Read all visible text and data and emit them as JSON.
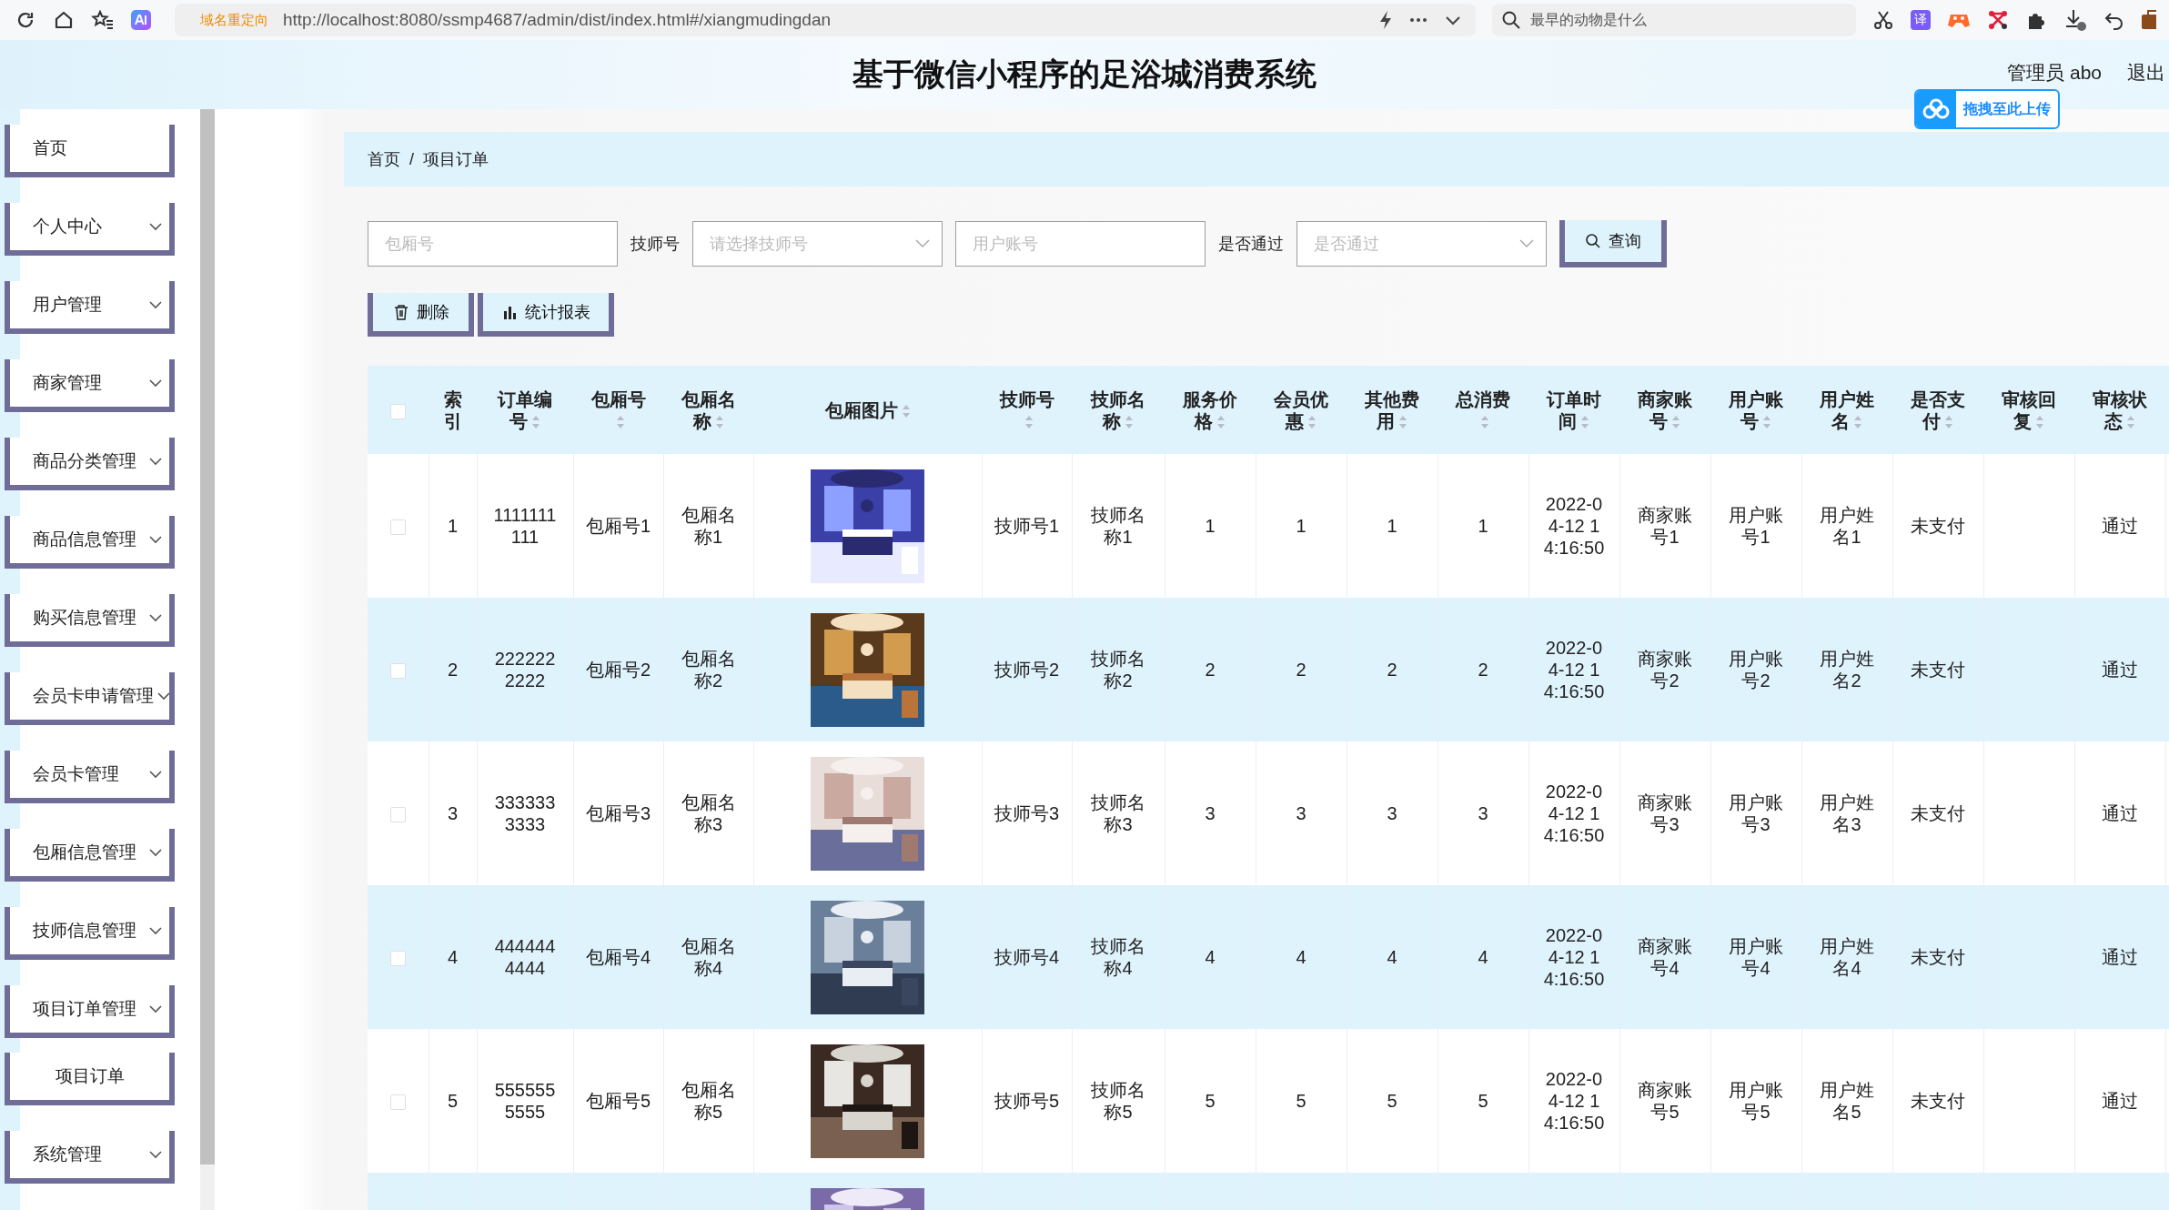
{
  "browser": {
    "redirect_tag": "域名重定向",
    "url": "http://localhost:8080/ssmp4687/admin/dist/index.html#/xiangmudingdan",
    "search": {
      "placeholder": "最早的动物是什么"
    },
    "translate_glyph": "译"
  },
  "header": {
    "title": "基于微信小程序的足浴城消费系统",
    "user": "管理员 abo",
    "logout": "退出",
    "upload_badge": "拖拽至此上传"
  },
  "sidebar": {
    "items": [
      {
        "label": "首页",
        "kind": "link"
      },
      {
        "label": "个人中心",
        "kind": "menu"
      },
      {
        "label": "用户管理",
        "kind": "menu"
      },
      {
        "label": "商家管理",
        "kind": "menu"
      },
      {
        "label": "商品分类管理",
        "kind": "menu"
      },
      {
        "label": "商品信息管理",
        "kind": "menu"
      },
      {
        "label": "购买信息管理",
        "kind": "menu"
      },
      {
        "label": "会员卡申请管理",
        "kind": "menu"
      },
      {
        "label": "会员卡管理",
        "kind": "menu"
      },
      {
        "label": "包厢信息管理",
        "kind": "menu"
      },
      {
        "label": "技师信息管理",
        "kind": "menu"
      },
      {
        "label": "项目订单管理",
        "kind": "menu",
        "children": [
          {
            "label": "项目订单",
            "kind": "link"
          }
        ]
      },
      {
        "label": "系统管理",
        "kind": "menu"
      }
    ]
  },
  "breadcrumb": [
    "首页",
    "/",
    "项目订单"
  ],
  "filters": [
    {
      "kind": "input",
      "placeholder": "包厢号"
    },
    {
      "kind": "label",
      "text": "技师号"
    },
    {
      "kind": "select",
      "placeholder": "请选择技师号"
    },
    {
      "kind": "input",
      "placeholder": "用户账号"
    },
    {
      "kind": "label",
      "text": "是否通过"
    },
    {
      "kind": "select",
      "placeholder": "是否通过"
    },
    {
      "kind": "button",
      "text": "查询"
    }
  ],
  "actions": [
    {
      "kind": "delete",
      "text": "删除"
    },
    {
      "kind": "report",
      "text": "统计报表"
    }
  ],
  "table": {
    "select_all": {
      "checked": false
    },
    "columns": [
      {
        "label": "索引",
        "sortable": false
      },
      {
        "label": "订单编号",
        "sortable": true
      },
      {
        "label": "包厢号",
        "sortable": true
      },
      {
        "label": "包厢名称",
        "sortable": true
      },
      {
        "label": "包厢图片",
        "sortable": true
      },
      {
        "label": "技师号",
        "sortable": true
      },
      {
        "label": "技师名称",
        "sortable": true
      },
      {
        "label": "服务价格",
        "sortable": true
      },
      {
        "label": "会员优惠",
        "sortable": true
      },
      {
        "label": "其他费用",
        "sortable": true
      },
      {
        "label": "总消费",
        "sortable": true
      },
      {
        "label": "订单时间",
        "sortable": true
      },
      {
        "label": "商家账号",
        "sortable": true
      },
      {
        "label": "用户账号",
        "sortable": true
      },
      {
        "label": "用户姓名",
        "sortable": true
      },
      {
        "label": "是否支付",
        "sortable": true
      },
      {
        "label": "审核回复",
        "sortable": true
      },
      {
        "label": "审核状态",
        "sortable": true
      }
    ],
    "rows": [
      {
        "selected": false,
        "cells": [
          "1",
          "1111111111",
          "包厢号1",
          "包厢名称1",
          {
            "kind": "picture"
          },
          "技师号1",
          "技师名称1",
          "1",
          "1",
          "1",
          "1",
          "2022-04-12 14:16:50",
          "商家账号1",
          "用户账号1",
          "用户姓名1",
          "未支付",
          null,
          "通过"
        ]
      },
      {
        "selected": false,
        "cells": [
          "2",
          "2222222222",
          "包厢号2",
          "包厢名称2",
          {
            "kind": "picture"
          },
          "技师号2",
          "技师名称2",
          "2",
          "2",
          "2",
          "2",
          "2022-04-12 14:16:50",
          "商家账号2",
          "用户账号2",
          "用户姓名2",
          "未支付",
          null,
          "通过"
        ]
      },
      {
        "selected": false,
        "cells": [
          "3",
          "3333333333",
          "包厢号3",
          "包厢名称3",
          {
            "kind": "picture"
          },
          "技师号3",
          "技师名称3",
          "3",
          "3",
          "3",
          "3",
          "2022-04-12 14:16:50",
          "商家账号3",
          "用户账号3",
          "用户姓名3",
          "未支付",
          null,
          "通过"
        ]
      },
      {
        "selected": false,
        "cells": [
          "4",
          "4444444444",
          "包厢号4",
          "包厢名称4",
          {
            "kind": "picture"
          },
          "技师号4",
          "技师名称4",
          "4",
          "4",
          "4",
          "4",
          "2022-04-12 14:16:50",
          "商家账号4",
          "用户账号4",
          "用户姓名4",
          "未支付",
          null,
          "通过"
        ]
      },
      {
        "selected": false,
        "cells": [
          "5",
          "5555555555",
          "包厢号5",
          "包厢名称5",
          {
            "kind": "picture"
          },
          "技师号5",
          "技师名称5",
          "5",
          "5",
          "5",
          "5",
          "2022-04-12 14:16:50",
          "商家账号5",
          "用户账号5",
          "用户姓名5",
          "未支付",
          null,
          "通过"
        ]
      },
      {
        "cells": [
          null,
          null,
          null,
          null,
          {
            "kind": "picture"
          },
          null,
          null,
          null,
          null,
          null,
          null,
          null,
          null,
          null,
          null,
          null,
          null,
          null
        ]
      }
    ]
  }
}
